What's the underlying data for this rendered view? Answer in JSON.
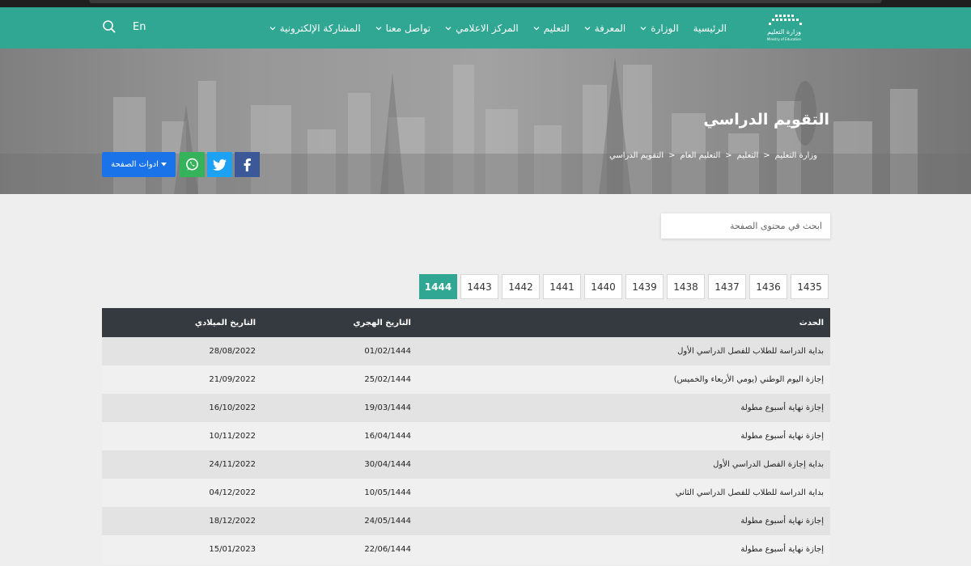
{
  "nav": {
    "logo_text": "وزارة التعليم",
    "logo_sub": "Ministry of Education",
    "items": [
      {
        "label": "الرئيسية",
        "has_dropdown": false
      },
      {
        "label": "الوزارة",
        "has_dropdown": true
      },
      {
        "label": "المعرفة",
        "has_dropdown": true
      },
      {
        "label": "التعليم",
        "has_dropdown": true
      },
      {
        "label": "المركز الاعلامي",
        "has_dropdown": true
      },
      {
        "label": "تواصل معنا",
        "has_dropdown": true
      },
      {
        "label": "المشاركة الإلكترونية",
        "has_dropdown": true
      }
    ],
    "lang": "En",
    "search_icon": "search-icon"
  },
  "hero": {
    "title": "التقويم الدراسي",
    "breadcrumb": [
      "وزارة التعليم",
      "التعليم",
      "التعليم العام",
      "التقويم الدراسي"
    ],
    "breadcrumb_sep": ">",
    "tools_label": "ادوات الصفحة"
  },
  "search": {
    "placeholder": "ابحث في محتوى الصفحة"
  },
  "years": [
    "1435",
    "1436",
    "1437",
    "1438",
    "1439",
    "1440",
    "1441",
    "1442",
    "1443",
    "1444"
  ],
  "active_year": "1444",
  "table": {
    "headers": {
      "event": "الحدث",
      "hijri": "التاريخ الهجري",
      "gregorian": "التاريخ الميلادي"
    },
    "rows": [
      {
        "event": "بداية الدراسة للطلاب للفصل الدراسي الأول",
        "hijri": "01/02/1444",
        "gregorian": "28/08/2022"
      },
      {
        "event": "إجازة اليوم الوطني (يومي الأربعاء والخميس)",
        "hijri": "25/02/1444",
        "gregorian": "21/09/2022"
      },
      {
        "event": "إجازة نهاية أسبوع مطولة",
        "hijri": "19/03/1444",
        "gregorian": "16/10/2022"
      },
      {
        "event": "إجازة نهاية أسبوع مطولة",
        "hijri": "16/04/1444",
        "gregorian": "10/11/2022"
      },
      {
        "event": "بداية إجازة الفصل الدراسي الأول",
        "hijri": "30/04/1444",
        "gregorian": "24/11/2022"
      },
      {
        "event": "بداية الدراسة للطلاب للفصل الدراسي الثاني",
        "hijri": "10/05/1444",
        "gregorian": "04/12/2022"
      },
      {
        "event": "إجازة نهاية أسبوع مطولة",
        "hijri": "24/05/1444",
        "gregorian": "18/12/2022"
      },
      {
        "event": "إجازة نهاية أسبوع مطولة",
        "hijri": "22/06/1444",
        "gregorian": "15/01/2023"
      }
    ]
  },
  "colors": {
    "brand": "#2fa792",
    "table_header": "#353a40",
    "facebook": "#3b5998",
    "twitter": "#1da1f2",
    "whatsapp": "#34b35a",
    "tools": "#1a73e8"
  }
}
